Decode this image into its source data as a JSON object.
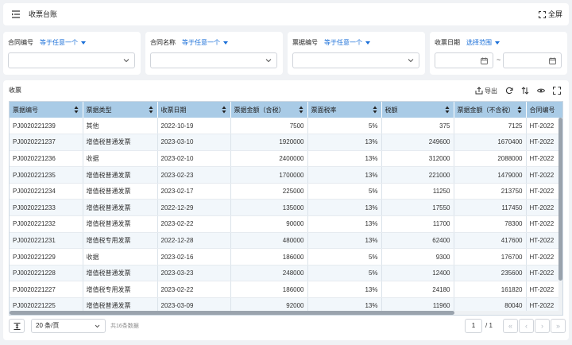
{
  "topbar": {
    "title": "收票台账",
    "fullscreen_label": "全屏"
  },
  "filters": [
    {
      "label": "合同编号",
      "operator": "等于任意一个"
    },
    {
      "label": "合同名称",
      "operator": "等于任意一个"
    },
    {
      "label": "票据编号",
      "operator": "等于任意一个"
    },
    {
      "label": "收票日期",
      "operator": "选择范围",
      "range_sep": "~"
    }
  ],
  "panel": {
    "title": "收票",
    "export_label": "导出"
  },
  "table": {
    "columns": [
      "票据编号",
      "票据类型",
      "收票日期",
      "票据金额（含税）",
      "票面税率",
      "税额",
      "票据金额（不含税）",
      "合同编号"
    ],
    "rows": [
      [
        "PJ0020221239",
        "其他",
        "2022-10-19",
        "7500",
        "5%",
        "375",
        "7125",
        "HT-2022"
      ],
      [
        "PJ0020221237",
        "增值税普通发票",
        "2023-03-10",
        "1920000",
        "13%",
        "249600",
        "1670400",
        "HT-2022"
      ],
      [
        "PJ0020221236",
        "收据",
        "2023-02-10",
        "2400000",
        "13%",
        "312000",
        "2088000",
        "HT-2022"
      ],
      [
        "PJ0020221235",
        "增值税普通发票",
        "2023-02-23",
        "1700000",
        "13%",
        "221000",
        "1479000",
        "HT-2022"
      ],
      [
        "PJ0020221234",
        "增值税普通发票",
        "2023-02-17",
        "225000",
        "5%",
        "11250",
        "213750",
        "HT-2022"
      ],
      [
        "PJ0020221233",
        "增值税普通发票",
        "2022-12-29",
        "135000",
        "13%",
        "17550",
        "117450",
        "HT-2022"
      ],
      [
        "PJ0020221232",
        "增值税普通发票",
        "2023-02-22",
        "90000",
        "13%",
        "11700",
        "78300",
        "HT-2022"
      ],
      [
        "PJ0020221231",
        "增值税专用发票",
        "2022-12-28",
        "480000",
        "13%",
        "62400",
        "417600",
        "HT-2022"
      ],
      [
        "PJ0020221229",
        "收据",
        "2023-02-16",
        "186000",
        "5%",
        "9300",
        "176700",
        "HT-2022"
      ],
      [
        "PJ0020221228",
        "增值税普通发票",
        "2023-03-23",
        "248000",
        "5%",
        "12400",
        "235600",
        "HT-2022"
      ],
      [
        "PJ0020221227",
        "增值税专用发票",
        "2023-02-22",
        "186000",
        "13%",
        "24180",
        "161820",
        "HT-2022"
      ],
      [
        "PJ0020221225",
        "增值税普通发票",
        "2023-03-09",
        "92000",
        "13%",
        "11960",
        "80040",
        "HT-2022"
      ]
    ]
  },
  "pager": {
    "page_size": "20 条/页",
    "total": "共16条数据",
    "current_page": "1",
    "total_pages": "/ 1"
  },
  "colors": {
    "header_bg": "#a9cbe6",
    "accent": "#1a6fd8",
    "row_alt": "#f2f7fb"
  }
}
